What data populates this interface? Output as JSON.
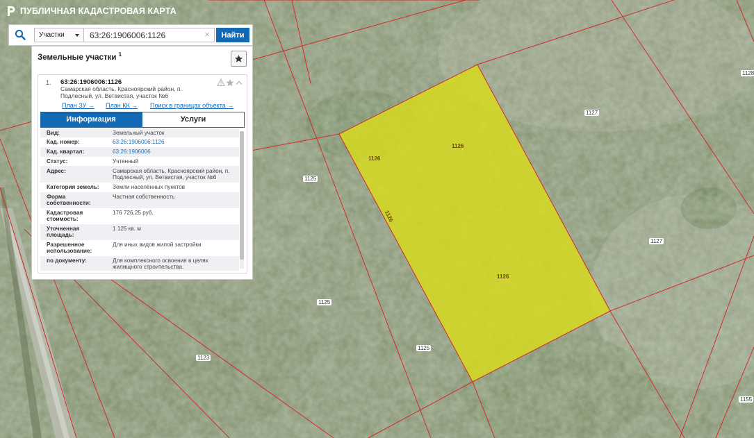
{
  "app": {
    "title": "ПУБЛИЧНАЯ КАДАСТРОВАЯ КАРТА"
  },
  "search": {
    "type_selected": "Участки",
    "query": "63:26:1906006:1126",
    "button_label": "Найти",
    "clear_glyph": "×"
  },
  "results": {
    "title": "Земельные участки",
    "count": "1",
    "favorites_icon": "star-icon",
    "items": [
      {
        "number": "1.",
        "cad_number": "63:26:1906006:1126",
        "address": "Самарская область, Красноярский район, п. Подлесный, ул. Ветвистая, участок №6",
        "links": {
          "plan_zu": "План ЗУ →",
          "plan_kk": "План КК →",
          "search_in_bounds": "Поиск в границах объекта →"
        }
      }
    ],
    "tabs": [
      "Информация",
      "Услуги"
    ],
    "active_tab": "Информация",
    "info_rows": [
      {
        "key": "Вид:",
        "value": "Земельный участок"
      },
      {
        "key": "Кад. номер:",
        "value": "63:26:1906006:1126"
      },
      {
        "key": "Кад. квартал:",
        "value": "63:26:1906006"
      },
      {
        "key": "Статус:",
        "value": "Учтенный"
      },
      {
        "key": "Адрес:",
        "value": "Самарская область, Красноярский район, п. Подлесный, ул. Ветвистая, участок №6"
      },
      {
        "key": "Категория земель:",
        "value": "Земли населённых пунктов"
      },
      {
        "key": "Форма собственности:",
        "value": "Частная собственность"
      },
      {
        "key": "Кадастровая стоимость:",
        "value": "176 726,25 руб."
      },
      {
        "key": "Уточненная площадь:",
        "value": "1 125 кв. м"
      },
      {
        "key": "Разрешенное использование:",
        "value": "Для иных видов жилой застройки"
      },
      {
        "key": "по документу:",
        "value": "Для комплексного освоения в целях жилищного строительства."
      }
    ]
  },
  "map": {
    "parcel_labels": [
      "1126",
      "1126",
      "1126",
      "1126",
      "1125",
      "1125",
      "1125",
      "1123",
      "1127",
      "1127",
      "1128",
      "1155"
    ],
    "colors": {
      "selected_fill": "#d8dc1c",
      "boundary": "#d42a2a",
      "accent": "#1469b4"
    }
  }
}
